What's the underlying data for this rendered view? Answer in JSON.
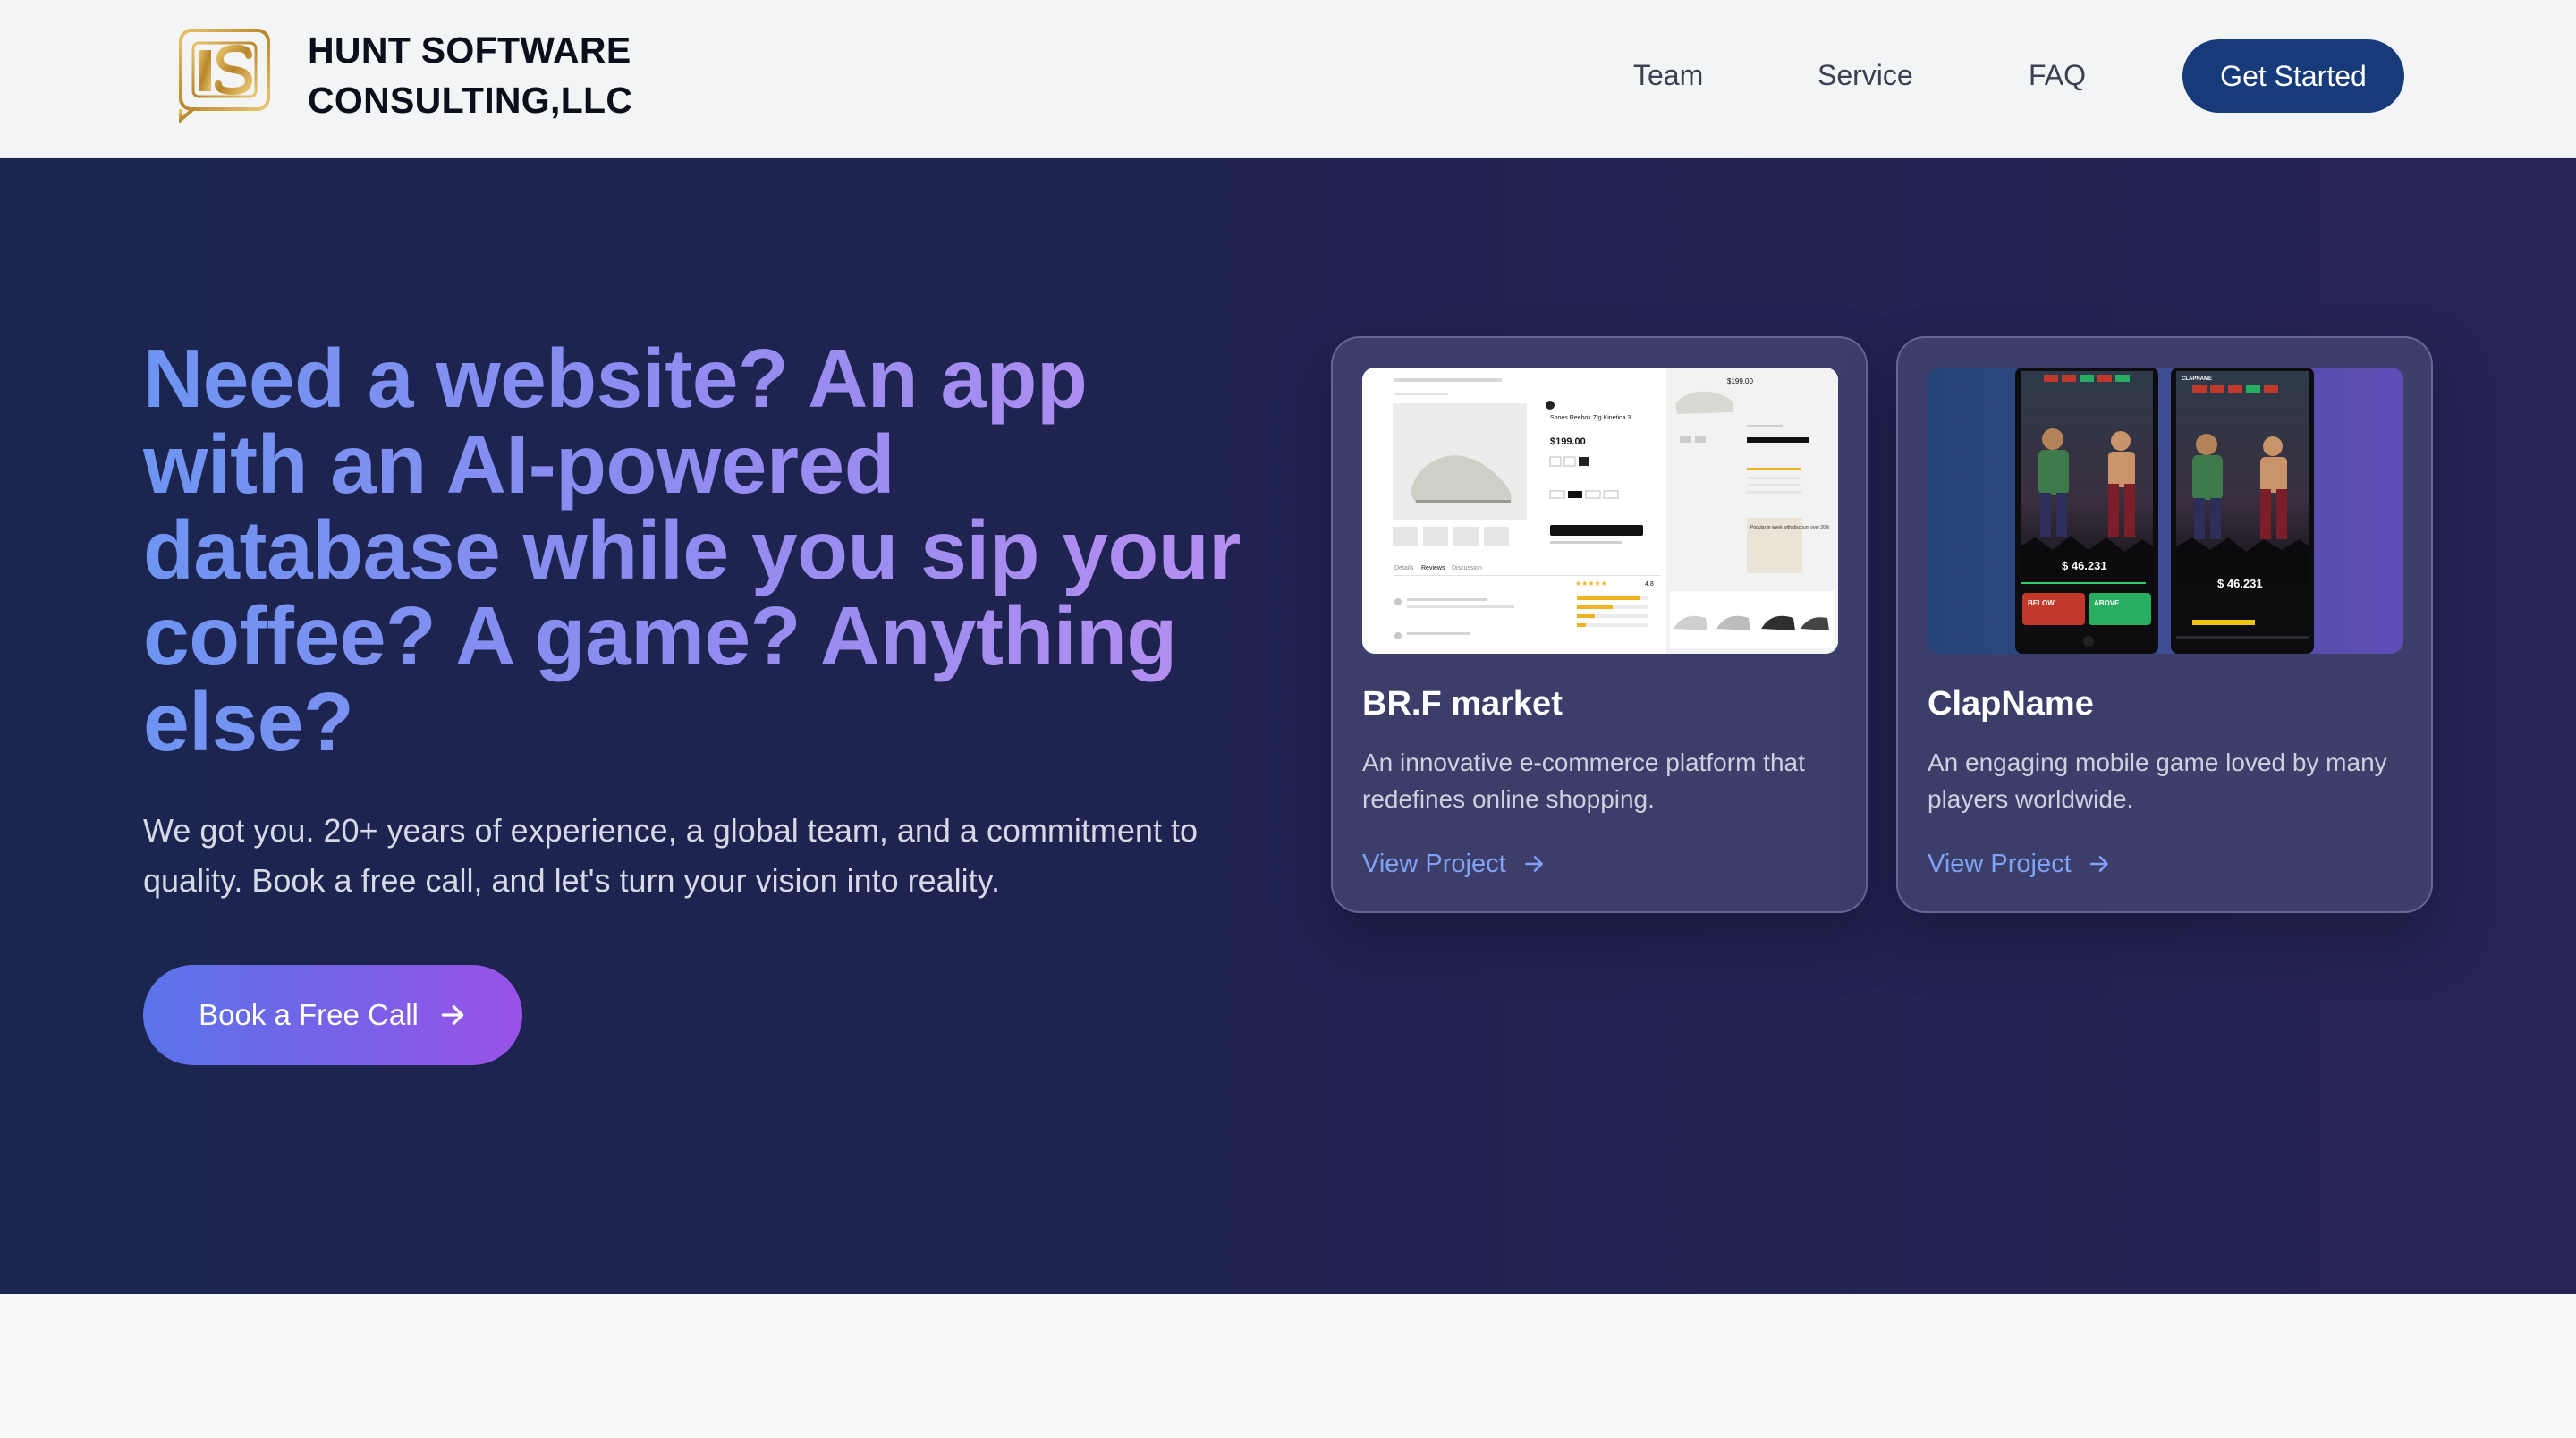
{
  "header": {
    "brand_line1": "HUNT SOFTWARE",
    "brand_line2": "CONSULTING,LLC",
    "nav": [
      {
        "label": "Team"
      },
      {
        "label": "Service"
      },
      {
        "label": "FAQ"
      }
    ],
    "cta_label": "Get Started"
  },
  "hero": {
    "headline": "Need a website? An app with an AI-powered database while you sip your coffee? A game? Anything else?",
    "subtext": "We got you. 20+ years of experience, a global team, and a commitment to quality. Book a free call, and let's turn your vision into reality.",
    "cta_label": "Book a Free Call"
  },
  "projects": [
    {
      "title": "BR.F market",
      "description": "An innovative e-commerce platform that redefines online shopping.",
      "link_label": "View Project",
      "thumb": {
        "product_name": "Shoes Reebok Zig Kinetica 3",
        "price": "$199.00",
        "side_price": "$199.00",
        "tabs": [
          "Details",
          "Reviews",
          "Discussion"
        ],
        "rating": "4.8",
        "promo": "Popular in week with discount over 20%"
      }
    },
    {
      "title": "ClapName",
      "description": "An engaging mobile game loved by many players worldwide.",
      "link_label": "View Project",
      "thumb": {
        "price_left": "$ 46.231",
        "price_right": "$ 46.231",
        "below_label": "BELOW",
        "above_label": "ABOVE",
        "brand": "CLAPNAME"
      }
    }
  ],
  "colors": {
    "header_bg": "#f3f4f6",
    "hero_bg": "#1e2450",
    "primary_button": "#173a7a",
    "link": "#7fa2f4"
  }
}
